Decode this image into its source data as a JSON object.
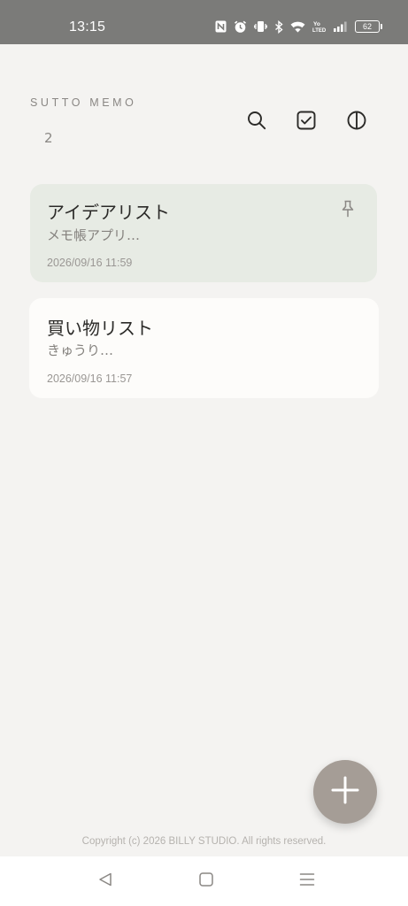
{
  "status_bar": {
    "time": "13:15",
    "battery_level": "62",
    "icons": [
      "nfc-icon",
      "alarm-icon",
      "vibrate-icon",
      "bluetooth-icon",
      "wifi-icon",
      "volte-icon",
      "signal-icon",
      "battery-icon"
    ]
  },
  "header": {
    "app_title": "SUTTO MEMO",
    "memo_count": "2",
    "actions": [
      "search-icon",
      "checkbox-select-icon",
      "theme-toggle-icon"
    ]
  },
  "memos": [
    {
      "title": "アイデアリスト",
      "preview": "メモ帳アプリ…",
      "date": "2026/09/16 11:59",
      "pinned": true,
      "background": "#e7ebe4"
    },
    {
      "title": "買い物リスト",
      "preview": "きゅうり…",
      "date": "2026/09/16 11:57",
      "pinned": false,
      "background": "#fdfcfa"
    }
  ],
  "fab": {
    "icon": "plus-icon",
    "color": "#a59d96"
  },
  "footer": {
    "copyright": "Copyright (c) 2026 BILLY STUDIO. All rights reserved."
  },
  "nav_bar": {
    "icons": [
      "back-icon",
      "home-icon",
      "recents-icon"
    ]
  },
  "colors": {
    "background": "#f4f3f1",
    "status_bar": "#7b7b79",
    "text_primary": "#2b2a28",
    "text_secondary": "#85827e"
  }
}
